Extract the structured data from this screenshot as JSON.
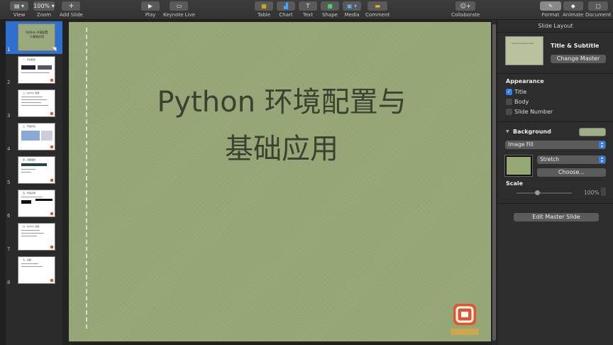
{
  "toolbar": {
    "view": "View",
    "zoom_value": "100%",
    "zoom": "Zoom",
    "add_slide": "Add Slide",
    "play": "Play",
    "keynote_live": "Keynote Live",
    "table": "Table",
    "chart": "Chart",
    "text": "Text",
    "shape": "Shape",
    "media": "Media",
    "comment": "Comment",
    "collaborate": "Collaborate",
    "format": "Format",
    "animate": "Animate",
    "document": "Document"
  },
  "navigator": {
    "slides": [
      {
        "num": "1",
        "title": "Python 环境配置与基础应用",
        "selected": true
      },
      {
        "num": "2",
        "title": "一、环境配置"
      },
      {
        "num": "3",
        "title": "二、Python 安装"
      },
      {
        "num": "4",
        "title": "三、开发环境"
      },
      {
        "num": "5",
        "title": "四、基础语法"
      },
      {
        "num": "6",
        "title": "五、代码示例"
      },
      {
        "num": "7",
        "title": "六、Python 应用"
      },
      {
        "num": "8",
        "title": "七、总结"
      }
    ]
  },
  "slide": {
    "title_line1": "Python 环境配置与",
    "title_line2": "基础应用",
    "background_color": "#97a877"
  },
  "inspector": {
    "header": "Slide Layout",
    "layout_thumb_text": "Layout preview Slide",
    "layout_name": "Title & Subtitle",
    "change_master": "Change Master",
    "appearance": "Appearance",
    "title_label": "Title",
    "title_checked": true,
    "body_label": "Body",
    "body_checked": false,
    "slide_number_label": "Slide Number",
    "slide_number_checked": false,
    "background": "Background",
    "fill_type": "Image Fill",
    "stretch": "Stretch",
    "choose": "Choose...",
    "scale": "Scale",
    "scale_value": "100%",
    "edit_master": "Edit Master Slide"
  },
  "colors": {
    "accent": "#2f7ff0",
    "selection": "#2f6fd0",
    "slide_green": "#97a877"
  }
}
